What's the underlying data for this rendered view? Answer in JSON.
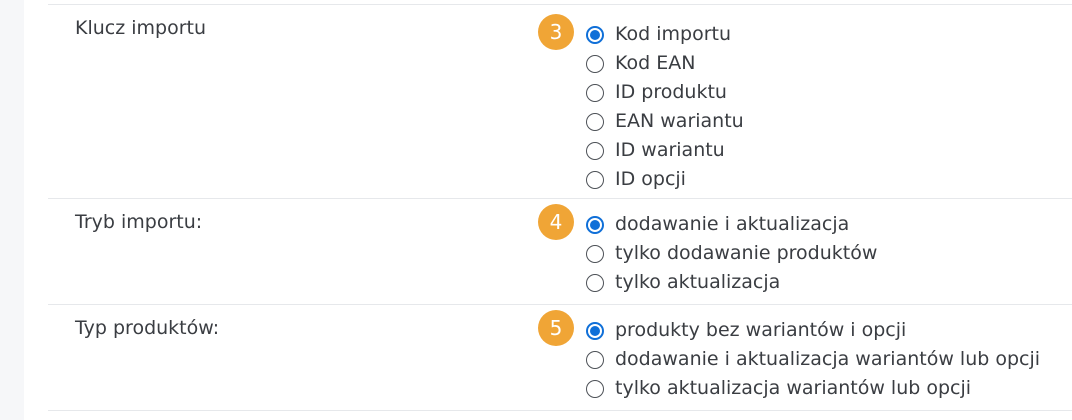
{
  "sections": [
    {
      "label": "Klucz importu",
      "step": "3",
      "options": [
        {
          "label": "Kod importu",
          "checked": true
        },
        {
          "label": "Kod EAN",
          "checked": false
        },
        {
          "label": "ID produktu",
          "checked": false
        },
        {
          "label": "EAN wariantu",
          "checked": false
        },
        {
          "label": "ID wariantu",
          "checked": false
        },
        {
          "label": "ID opcji",
          "checked": false
        }
      ]
    },
    {
      "label": "Tryb importu:",
      "step": "4",
      "options": [
        {
          "label": "dodawanie i aktualizacja",
          "checked": true
        },
        {
          "label": "tylko dodawanie produktów",
          "checked": false
        },
        {
          "label": "tylko aktualizacja",
          "checked": false
        }
      ]
    },
    {
      "label": "Typ produktów:",
      "step": "5",
      "options": [
        {
          "label": "produkty bez wariantów i opcji",
          "checked": true
        },
        {
          "label": "dodawanie i aktualizacja wariantów lub opcji",
          "checked": false
        },
        {
          "label": "tylko aktualizacja wariantów lub opcji",
          "checked": false
        }
      ]
    }
  ],
  "colors": {
    "badge": "#f0a536",
    "radio_checked": "#0f6fd8",
    "divider": "#e6e8eb"
  }
}
